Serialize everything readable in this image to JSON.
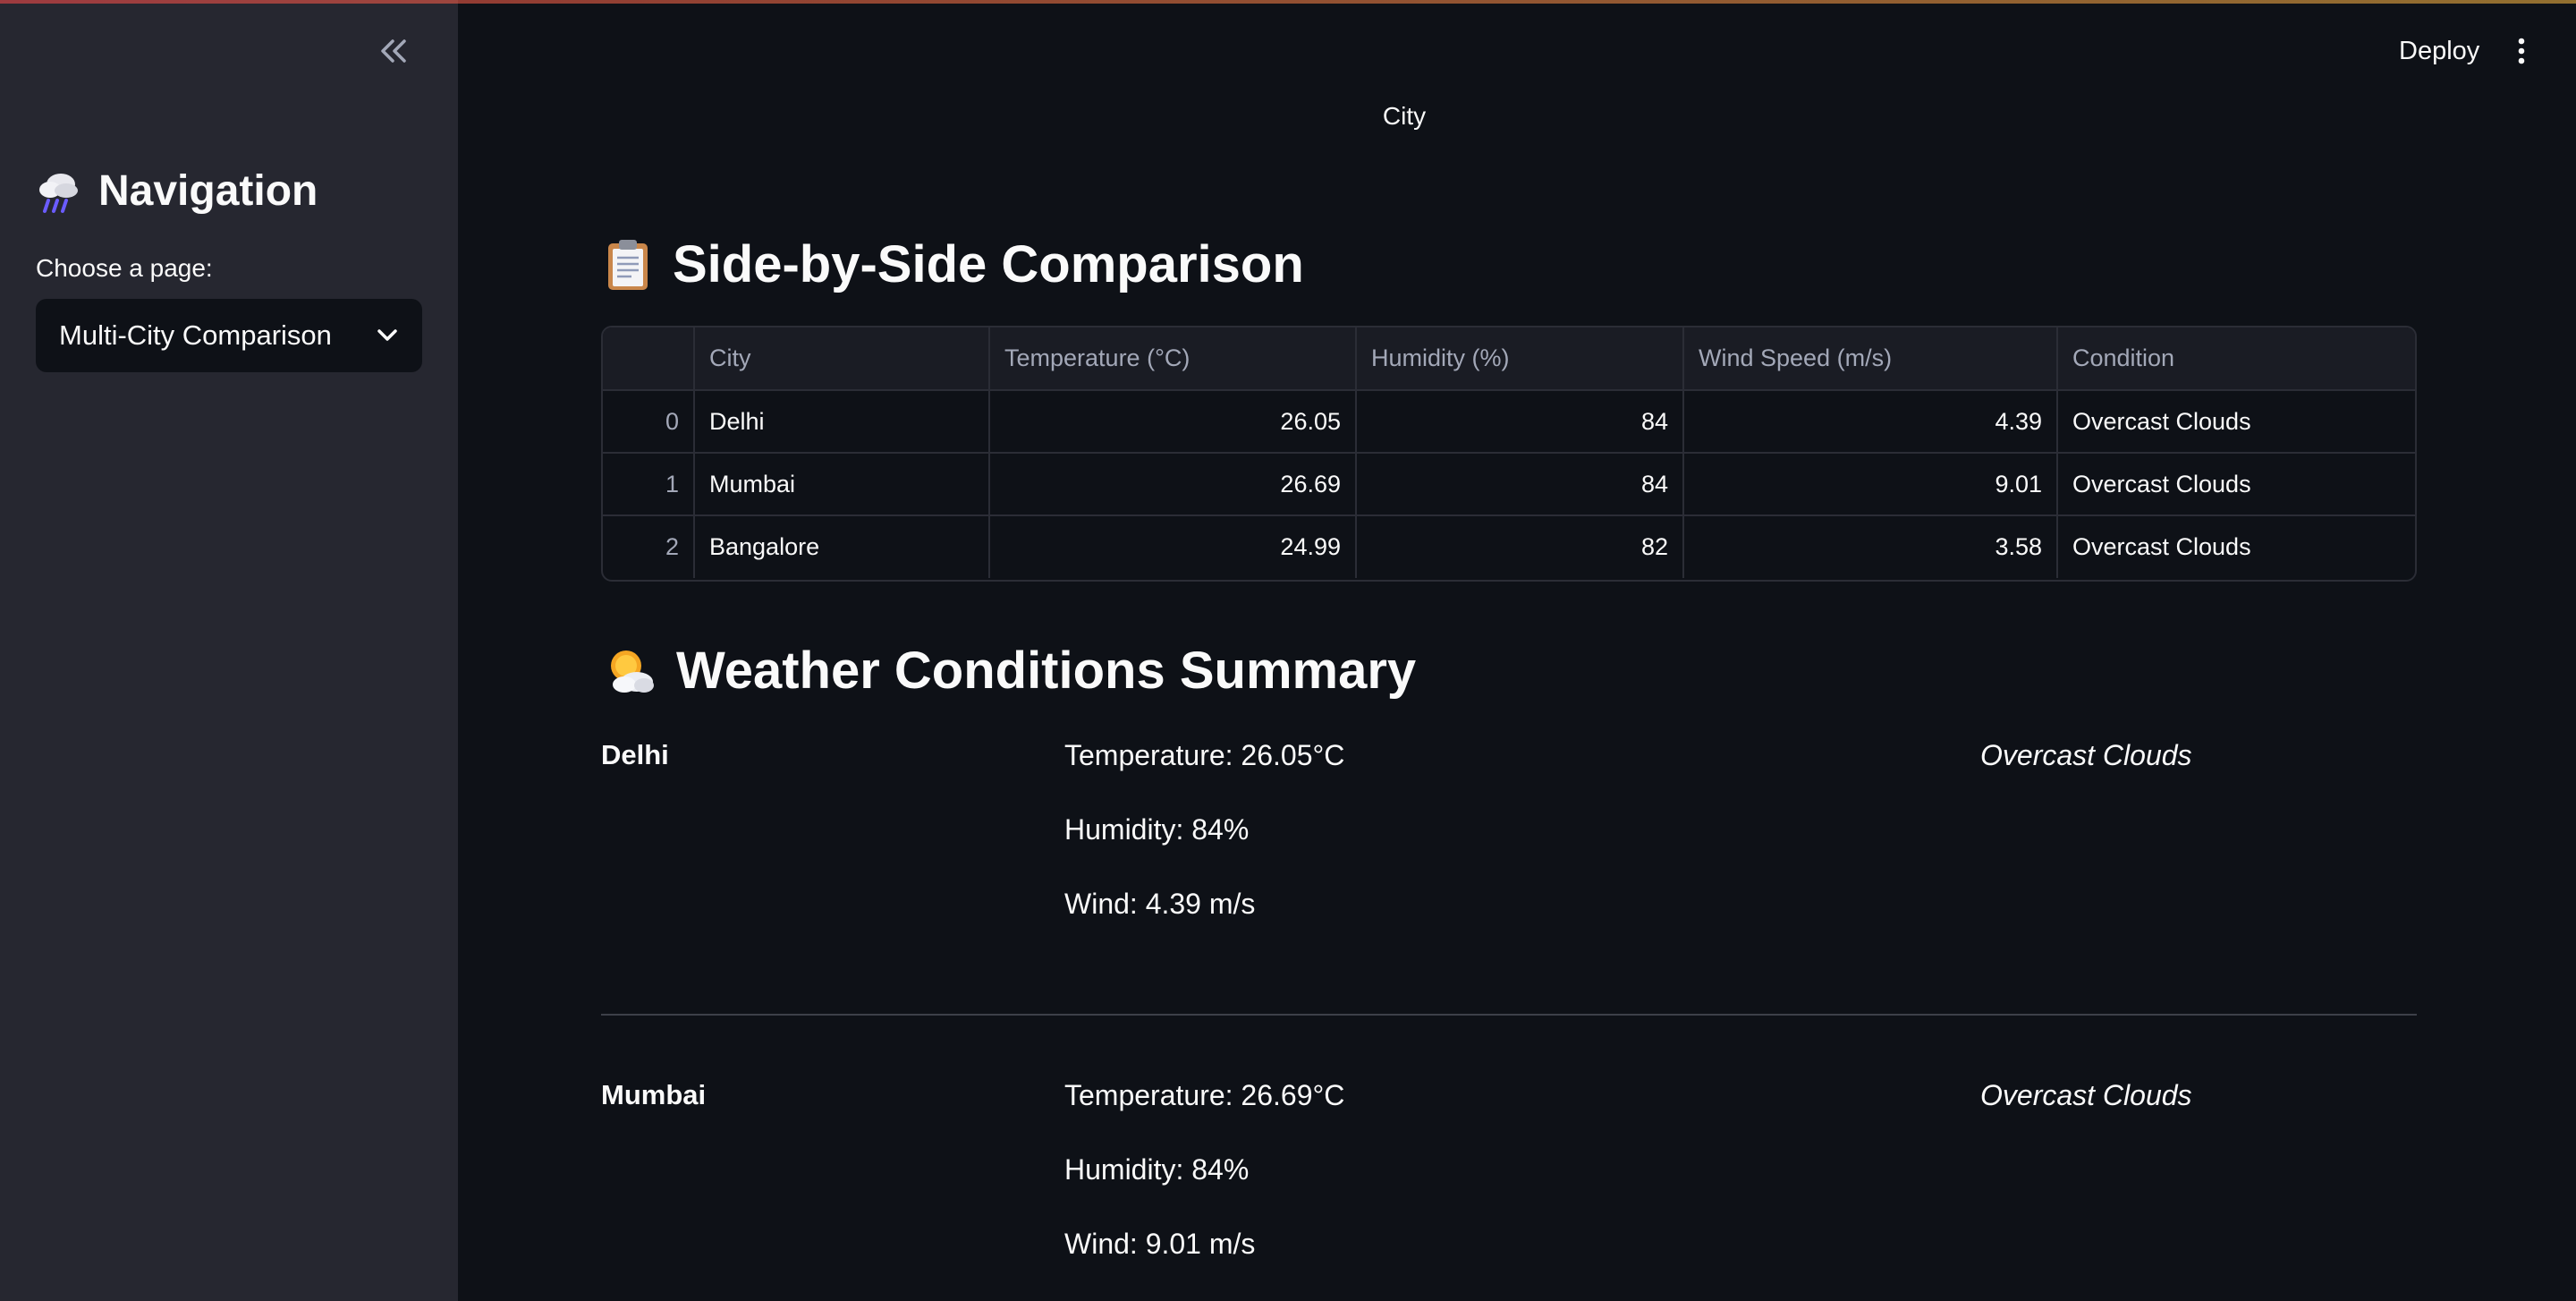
{
  "sidebar": {
    "collapse_icon": "double-chevron-left",
    "title_icon": "cloud-rain-emoji",
    "title": "Navigation",
    "select_label": "Choose a page:",
    "select_value": "Multi-City Comparison"
  },
  "header": {
    "deploy_label": "Deploy",
    "menu_icon": "vertical-dots"
  },
  "main": {
    "city_label": "City",
    "comparison": {
      "icon": "clipboard-emoji",
      "heading": "Side-by-Side Comparison",
      "columns": [
        "",
        "City",
        "Temperature (°C)",
        "Humidity (%)",
        "Wind Speed (m/s)",
        "Condition"
      ],
      "rows": [
        {
          "index": "0",
          "city": "Delhi",
          "temperature": "26.05",
          "humidity": "84",
          "wind": "4.39",
          "condition": "Overcast Clouds"
        },
        {
          "index": "1",
          "city": "Mumbai",
          "temperature": "26.69",
          "humidity": "84",
          "wind": "9.01",
          "condition": "Overcast Clouds"
        },
        {
          "index": "2",
          "city": "Bangalore",
          "temperature": "24.99",
          "humidity": "82",
          "wind": "3.58",
          "condition": "Overcast Clouds"
        }
      ]
    },
    "summary": {
      "icon": "sun-behind-cloud-emoji",
      "heading": "Weather Conditions Summary",
      "cities": [
        {
          "name": "Delhi",
          "temperature": "Temperature: 26.05°C",
          "humidity": "Humidity: 84%",
          "wind": "Wind: 4.39 m/s",
          "condition": "Overcast Clouds"
        },
        {
          "name": "Mumbai",
          "temperature": "Temperature: 26.69°C",
          "humidity": "Humidity: 84%",
          "wind": "Wind: 9.01 m/s",
          "condition": "Overcast Clouds"
        }
      ]
    }
  },
  "colors": {
    "sidebar_bg": "#262730",
    "main_bg": "#0e1117",
    "text": "#fafafa",
    "muted_text": "#a3a8b8",
    "border": "#2b2d36"
  }
}
